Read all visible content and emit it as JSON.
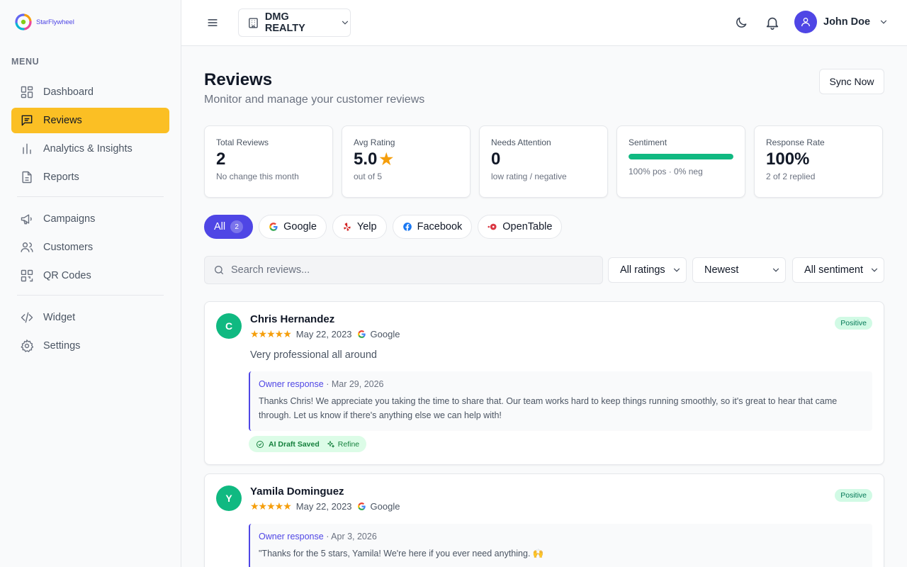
{
  "brand": {
    "name": "StarFlywheel"
  },
  "sidebar": {
    "menu_label": "MENU",
    "items": [
      {
        "label": "Dashboard",
        "icon": "dashboard-icon"
      },
      {
        "label": "Reviews",
        "icon": "message-square-icon",
        "active": true
      },
      {
        "label": "Analytics & Insights",
        "icon": "bar-chart-icon"
      },
      {
        "label": "Reports",
        "icon": "file-text-icon"
      },
      {
        "label": "Campaigns",
        "icon": "megaphone-icon"
      },
      {
        "label": "Customers",
        "icon": "users-icon"
      },
      {
        "label": "QR Codes",
        "icon": "qr-code-icon"
      },
      {
        "label": "Widget",
        "icon": "code-icon"
      },
      {
        "label": "Settings",
        "icon": "gear-icon"
      }
    ]
  },
  "topbar": {
    "org_name": "DMG REALTY",
    "user_name": "John Doe"
  },
  "page": {
    "title": "Reviews",
    "subtitle": "Monitor and manage your customer reviews",
    "sync_label": "Sync Now"
  },
  "stats": [
    {
      "label": "Total Reviews",
      "value": "2",
      "note": "No change this month"
    },
    {
      "label": "Avg Rating",
      "value": "5.0",
      "star": "★",
      "note": "out of 5"
    },
    {
      "label": "Needs Attention",
      "value": "0",
      "note": "low rating / negative"
    },
    {
      "label": "Sentiment",
      "positive_fraction": 1.0,
      "note": "100% pos · 0% neg"
    },
    {
      "label": "Response Rate",
      "value": "100%",
      "note": "2 of 2 replied"
    }
  ],
  "source_filters": [
    {
      "label": "All",
      "count": "2",
      "active": true
    },
    {
      "label": "Google"
    },
    {
      "label": "Yelp"
    },
    {
      "label": "Facebook"
    },
    {
      "label": "OpenTable"
    }
  ],
  "search": {
    "placeholder": "Search reviews..."
  },
  "selects": {
    "rating": "All ratings",
    "sort": "Newest",
    "sentiment": "All sentiment"
  },
  "reviews": [
    {
      "initial": "C",
      "name": "Chris Hernandez",
      "stars": "★★★★★",
      "date": "May 22, 2023",
      "source": "Google",
      "sentiment": "Positive",
      "text": "Very professional all around",
      "response_label": "Owner response",
      "response_date": "· Mar 29, 2026",
      "response_text": "Thanks Chris! We appreciate you taking the time to share that. Our team works hard to keep things running smoothly, so it's great to hear that came through. Let us know if there's anything else we can help with!",
      "draft_label": "AI Draft Saved",
      "refine_label": "Refine"
    },
    {
      "initial": "Y",
      "name": "Yamila Dominguez",
      "stars": "★★★★★",
      "date": "May 22, 2023",
      "source": "Google",
      "sentiment": "Positive",
      "response_label": "Owner response",
      "response_date": "· Apr 3, 2026",
      "response_text": "\"Thanks for the 5 stars, Yamila! We're here if you ever need anything. 🙌"
    }
  ],
  "colors": {
    "accent": "#4f46e5",
    "active_nav": "#fbbf24",
    "positive": "#10b981",
    "star": "#f59e0b"
  }
}
